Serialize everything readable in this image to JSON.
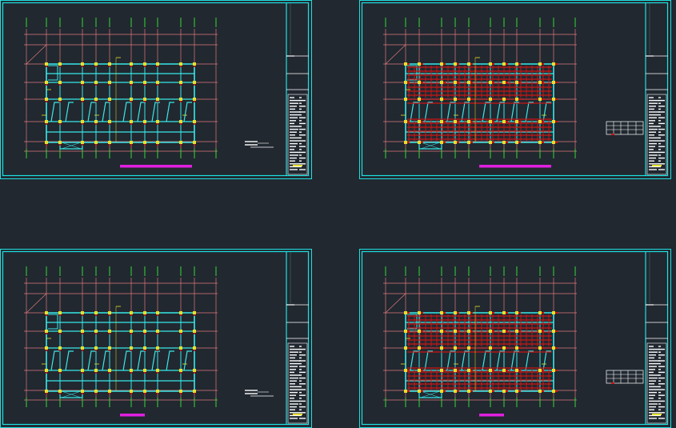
{
  "canvas": {
    "background": "#212830",
    "title": ""
  },
  "colors": {
    "frame": "#1fe0e0",
    "axis": "#e07a7a",
    "grid_tick": "#38d838",
    "beam": "#38e8e8",
    "column": "#e8e02a",
    "rebar": "#cc1414",
    "label_bar": "#e020e0",
    "title_block": "#ffffff"
  },
  "sheets": [
    {
      "id": "sheet-top-left",
      "variant": "framing",
      "label_bar_fraction": 0.62
    },
    {
      "id": "sheet-top-right",
      "variant": "reinforced",
      "label_bar_fraction": 0.62
    },
    {
      "id": "sheet-bottom-left",
      "variant": "framing",
      "label_bar_fraction": 0.22
    },
    {
      "id": "sheet-bottom-right",
      "variant": "reinforced",
      "label_bar_fraction": 0.22
    }
  ]
}
